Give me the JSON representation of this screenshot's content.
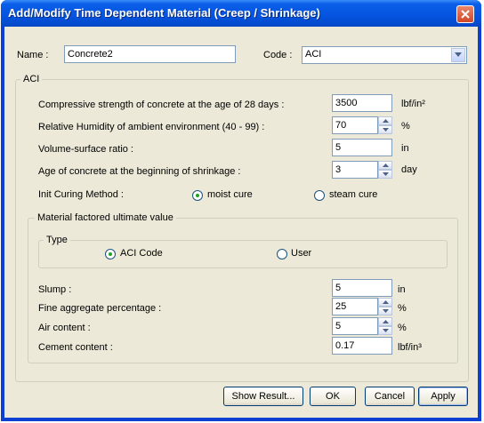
{
  "window": {
    "title": "Add/Modify Time Dependent Material (Creep / Shrinkage)"
  },
  "header": {
    "name_label": "Name :",
    "name_value": "Concrete2",
    "code_label": "Code :",
    "code_value": "ACI"
  },
  "aci_group": {
    "legend": "ACI",
    "fields": [
      {
        "label": "Compressive strength of concrete at the age of 28 days :",
        "value": "3500",
        "unit": "lbf/in²"
      },
      {
        "label": "Relative Humidity of ambient environment (40 - 99) :",
        "value": "70",
        "unit": "%"
      },
      {
        "label": "Volume-surface ratio :",
        "value": "5",
        "unit": "in"
      },
      {
        "label": "Age of concrete at the beginning of shrinkage :",
        "value": "3",
        "unit": "day"
      }
    ],
    "curing": {
      "label": "Init Curing Method :",
      "options": [
        "moist cure",
        "steam cure"
      ],
      "selected": "moist cure"
    },
    "material": {
      "legend": "Material factored ultimate value",
      "type_legend": "Type",
      "type_options": [
        "ACI Code",
        "User"
      ],
      "type_selected": "ACI Code",
      "fields": [
        {
          "label": "Slump :",
          "value": "5",
          "unit": "in"
        },
        {
          "label": "Fine aggregate percentage :",
          "value": "25",
          "unit": "%"
        },
        {
          "label": "Air content :",
          "value": "5",
          "unit": "%"
        },
        {
          "label": "Cement content :",
          "value": "0.17",
          "unit": "lbf/in³"
        }
      ]
    }
  },
  "buttons": {
    "show_result": "Show Result...",
    "ok": "OK",
    "cancel": "Cancel",
    "apply": "Apply"
  }
}
